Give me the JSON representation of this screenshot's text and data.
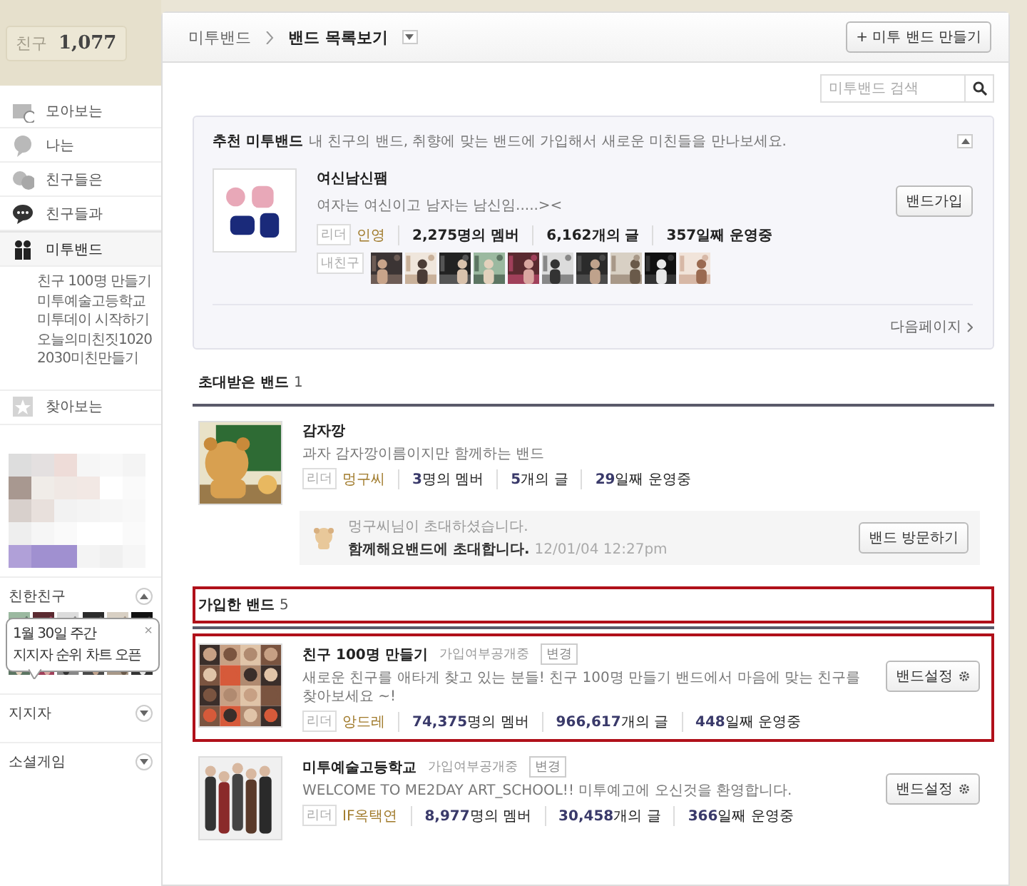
{
  "sidebar": {
    "friend_label": "친구",
    "friend_count": "1,077",
    "menu": [
      {
        "label": "모아보는",
        "kind": "calendar",
        "selected": false
      },
      {
        "label": "나는",
        "kind": "bubble",
        "selected": false
      },
      {
        "label": "친구들은",
        "kind": "bubbles",
        "selected": false
      },
      {
        "label": "친구들과",
        "kind": "chat",
        "selected": false
      },
      {
        "label": "미투밴드",
        "kind": "people",
        "selected": true,
        "children": [
          {
            "label": "친구 100명 만들기"
          },
          {
            "label": "미투예술고등학교"
          },
          {
            "label": "미투데이 시작하기"
          },
          {
            "label": "오늘의미친짓1020"
          },
          {
            "label": "2030미친만들기"
          }
        ]
      },
      {
        "label": "찾아보는",
        "kind": "star",
        "selected": false
      }
    ],
    "sections": [
      {
        "title": "친한친구",
        "expanded": true
      },
      {
        "title": "지지자",
        "expanded": false
      },
      {
        "title": "소셜게임",
        "expanded": false
      }
    ],
    "tooltip": {
      "lines": [
        "1월 30일 주간",
        "지지자 순위 차트 오픈"
      ],
      "close": "×"
    }
  },
  "header": {
    "breadcrumb": [
      "미투밴드",
      "밴드 목록보기"
    ],
    "create_button": "+ 미투 밴드 만들기"
  },
  "search": {
    "placeholder": "미투밴드 검색"
  },
  "recommended": {
    "title": "추천 미투밴드",
    "description": "내 친구의 밴드, 취향에 맞는 밴드에 가입해서 새로운 미친들을 만나보세요.",
    "expanded": true,
    "band": {
      "name": "여신남신팸",
      "description": "여자는 여신이고 남자는 남신임.....><",
      "leader_tag": "리더",
      "leader": "인영",
      "stats": [
        "2,275명의 멤버",
        "6,162개의 글",
        "357일째 운영중"
      ],
      "friends_tag": "내친구",
      "button": "밴드가입"
    },
    "next": "다음페이지"
  },
  "invited": {
    "title": "초대받은 밴드",
    "count": "1",
    "highlighted": false,
    "bands": [
      {
        "name": "감자깡",
        "description": "과자 감자깡이름이지만 함께하는 밴드",
        "leader_tag": "리더",
        "leader": "멍구씨",
        "stats": [
          "**3**명의 멤버",
          "**5**개의 글",
          "**29**일째 운영중"
        ],
        "highlighted": false,
        "invite": {
          "from": "멍구씨님이 초대하셨습니다.",
          "message": "함께해요밴드에 초대합니다.",
          "time": "12/01/04 12:27pm",
          "button": "밴드 방문하기"
        }
      }
    ]
  },
  "joined": {
    "title": "가입한 밴드",
    "count": "5",
    "highlighted": true,
    "bands": [
      {
        "name": "친구 100명 만들기",
        "privacy": "가입여부공개중",
        "change": "변경",
        "description": "새로운 친구를 애타게 찾고 있는 분들! 친구 100명 만들기 밴드에서 마음에 맞는 친구를 찾아보세요 ~!",
        "leader_tag": "리더",
        "leader": "앙드레",
        "stats": [
          "**74,375**명의 멤버",
          "**966,617**개의 글",
          "**448**일째 운영중"
        ],
        "button": "밴드설정",
        "highlighted": true
      },
      {
        "name": "미투예술고등학교",
        "privacy": "가입여부공개중",
        "change": "변경",
        "description": "WELCOME TO ME2DAY ART_SCHOOL!! 미투예고에 오신것을 환영합니다.",
        "leader_tag": "리더",
        "leader": "IF옥택연",
        "stats": [
          "**8,977**명의 멤버",
          "**30,458**개의 글",
          "**366**일째 운영중"
        ],
        "button": "밴드설정",
        "highlighted": false
      }
    ]
  }
}
